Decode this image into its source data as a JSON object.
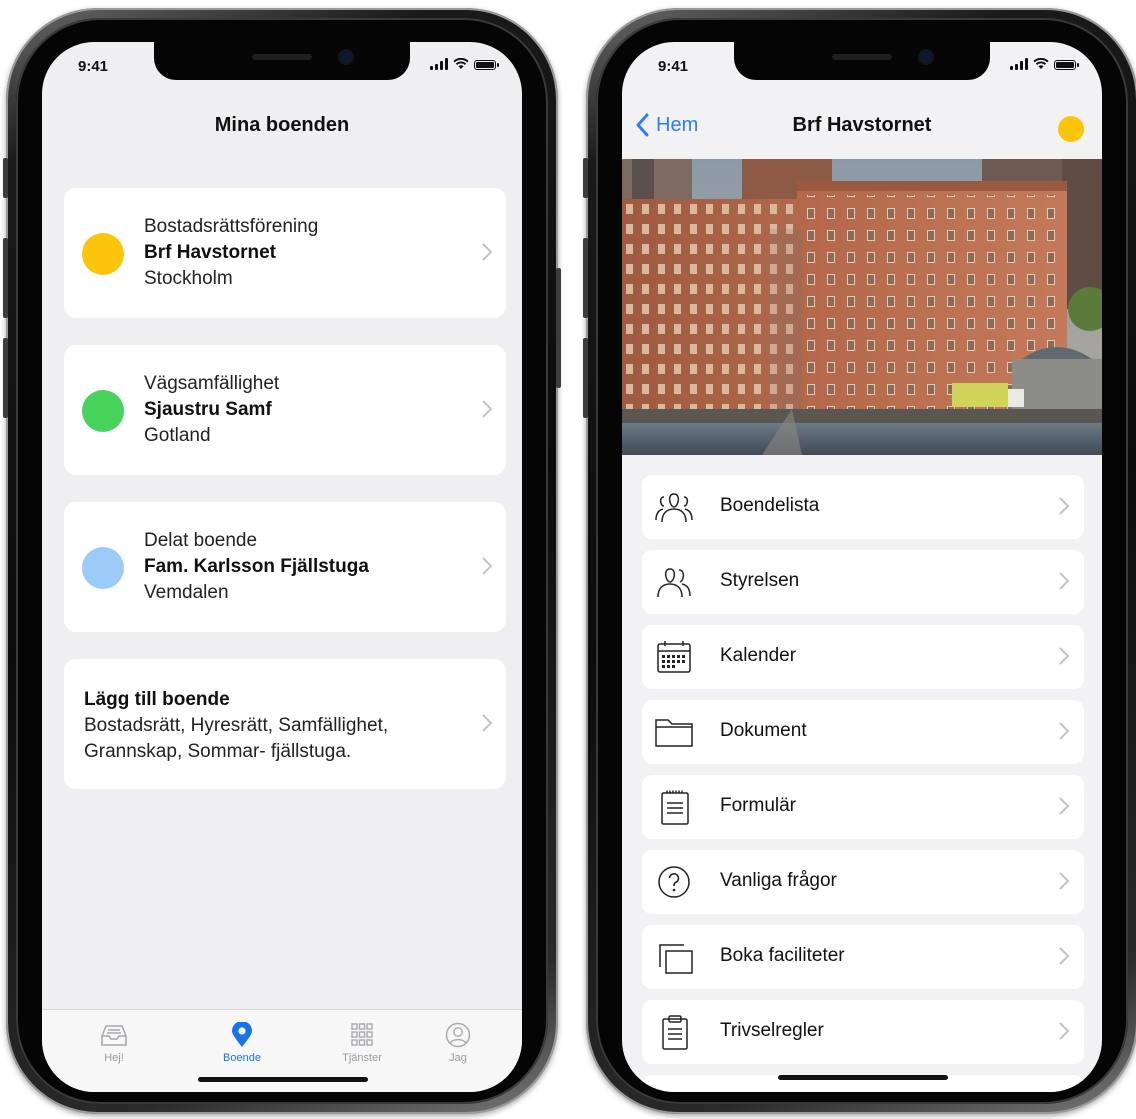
{
  "status": {
    "time": "9:41"
  },
  "left_screen": {
    "title": "Mina boenden",
    "cards": [
      {
        "category": "Bostadsrättsförening",
        "name": "Brf Havstornet",
        "location": "Stockholm",
        "dot_color": "#fbc60a"
      },
      {
        "category": "Vägsamfällighet",
        "name": "Sjaustru Samf",
        "location": "Gotland",
        "dot_color": "#47d35b"
      },
      {
        "category": "Delat boende",
        "name": "Fam. Karlsson Fjällstuga",
        "location": "Vemdalen",
        "dot_color": "#9dcbf7"
      }
    ],
    "add_card": {
      "title": "Lägg till boende",
      "line1": "Bostadsrätt, Hyresrätt, Samfällighet,",
      "line2": "Grannskap, Sommar- fjällstuga."
    },
    "tabs": [
      {
        "label": "Hej!",
        "icon": "inbox-icon"
      },
      {
        "label": "Boende",
        "icon": "location-pin-icon",
        "active": true
      },
      {
        "label": "Tjänster",
        "icon": "grid-icon"
      },
      {
        "label": "Jag",
        "icon": "person-icon"
      }
    ],
    "accent_color": "#1a73e8"
  },
  "right_screen": {
    "back_label": "Hem",
    "title": "Brf Havstornet",
    "dot_color": "#fbc60a",
    "hero": "building-photo",
    "menu": [
      {
        "label": "Boendelista",
        "icon": "people-group-icon"
      },
      {
        "label": "Styrelsen",
        "icon": "people-pair-icon"
      },
      {
        "label": "Kalender",
        "icon": "calendar-icon"
      },
      {
        "label": "Dokument",
        "icon": "folder-icon"
      },
      {
        "label": "Formulär",
        "icon": "notepad-icon"
      },
      {
        "label": "Vanliga frågor",
        "icon": "question-icon"
      },
      {
        "label": "Boka faciliteter",
        "icon": "stacked-squares-icon"
      },
      {
        "label": "Trivselregler",
        "icon": "clipboard-icon"
      }
    ],
    "accent_color": "#2f7df6"
  }
}
